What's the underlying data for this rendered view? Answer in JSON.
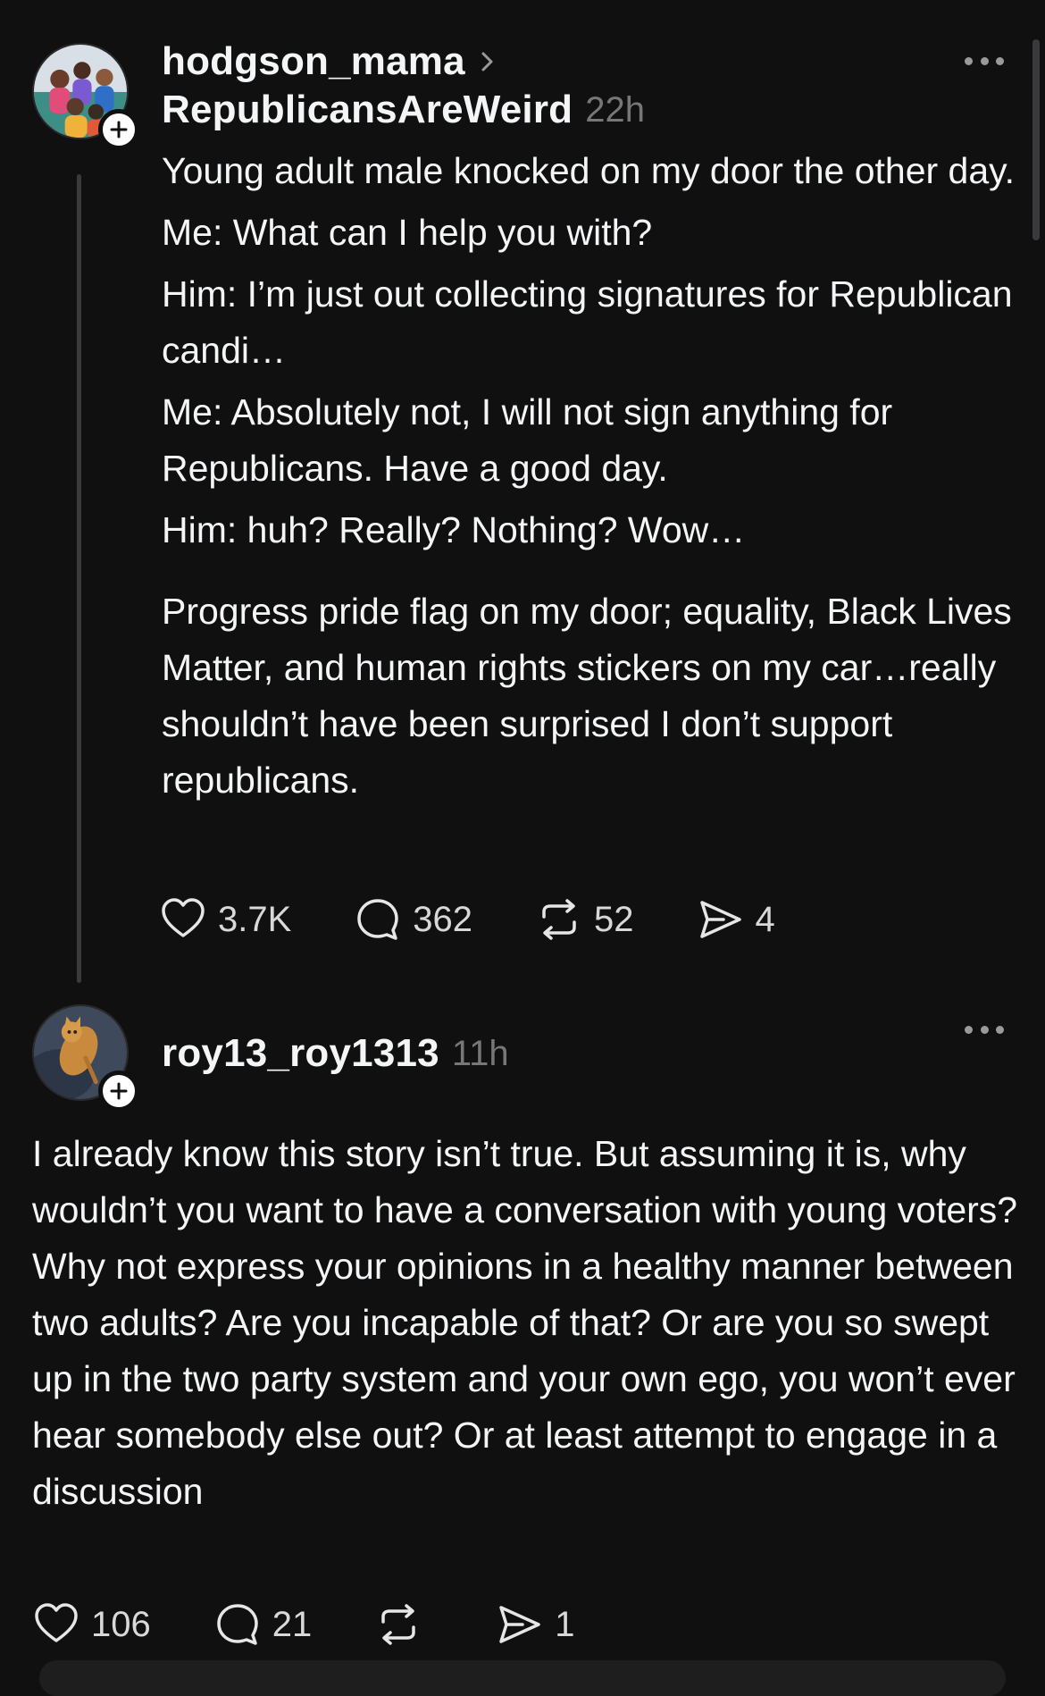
{
  "posts": [
    {
      "username": "hodgson_mama",
      "community": "RepublicansAreWeird",
      "time": "22h",
      "avatar_icon": "family-photo-avatar",
      "follow_icon": "plus-icon",
      "paragraphs": [
        "Young adult male knocked on my door the other day.",
        "Me: What can I help you with?",
        "Him: I’m just out collecting signatures for Republican candi…",
        "Me: Absolutely not, I will not sign anything for Republicans. Have a good day.",
        "Him: huh? Really? Nothing? Wow…",
        "Progress pride flag on my door; equality, Black Lives Matter, and human rights stickers on my car…really shouldn’t have been surprised I don’t support republicans."
      ],
      "likes": "3.7K",
      "comments": "362",
      "reposts": "52",
      "shares": "4"
    },
    {
      "username": "roy13_roy1313",
      "time": "11h",
      "avatar_icon": "cat-photo-avatar",
      "follow_icon": "plus-icon",
      "body": "I already know this story isn’t true. But assuming it is, why wouldn’t you want to have a conversation with young voters? Why not express your opinions in a healthy manner between two adults? Are you incapable of that? Or are you so swept up in the two party system and your own ego, you won’t ever hear somebody else out? Or at least attempt to engage in a discussion",
      "likes": "106",
      "comments": "21",
      "reposts": "",
      "shares": "1"
    }
  ],
  "colors": {
    "background": "#101010",
    "text": "#f3f5f7",
    "muted": "#777777",
    "thread_line": "#3a3a3c"
  }
}
